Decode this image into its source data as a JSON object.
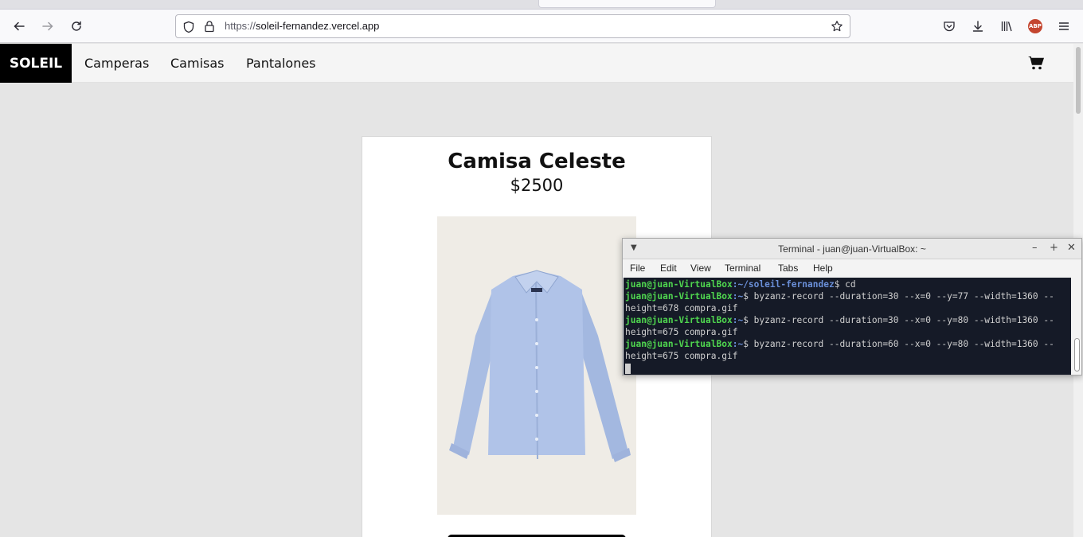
{
  "browser": {
    "url_protocol": "https://",
    "url_host": "soleil-fernandez.vercel.app",
    "abp_badge": "ABP"
  },
  "site": {
    "brand": "SOLEIL",
    "nav": [
      "Camperas",
      "Camisas",
      "Pantalones"
    ]
  },
  "product": {
    "title": "Camisa Celeste",
    "price": "$2500"
  },
  "terminal": {
    "title": "Terminal - juan@juan-VirtualBox: ~",
    "menu": [
      "File",
      "Edit",
      "View",
      "Terminal",
      "Tabs",
      "Help"
    ],
    "lines": [
      {
        "user": "juan@juan-VirtualBox",
        "path": ":~/soleil-fernandez",
        "cmd": "$ cd"
      },
      {
        "user": "juan@juan-VirtualBox",
        "path": ":~",
        "cmd": "$ byzanz-record --duration=30 --x=0 --y=77 --width=1360 --"
      },
      {
        "text": "height=678 compra.gif"
      },
      {
        "user": "juan@juan-VirtualBox",
        "path": ":~",
        "cmd": "$ byzanz-record --duration=30 --x=0 --y=80 --width=1360 --"
      },
      {
        "text": "height=675 compra.gif"
      },
      {
        "user": "juan@juan-VirtualBox",
        "path": ":~",
        "cmd": "$ byzanz-record --duration=60 --x=0 --y=80 --width=1360 --"
      },
      {
        "text": "height=675 compra.gif"
      }
    ]
  },
  "icons": {
    "back": "arrow-left-icon",
    "forward": "arrow-right-icon",
    "reload": "reload-icon",
    "shield": "shield-icon",
    "lock": "lock-icon",
    "star": "star-icon",
    "pocket": "pocket-icon",
    "download": "download-icon",
    "library": "library-icon",
    "menu": "hamburger-menu-icon",
    "cart": "cart-icon"
  }
}
